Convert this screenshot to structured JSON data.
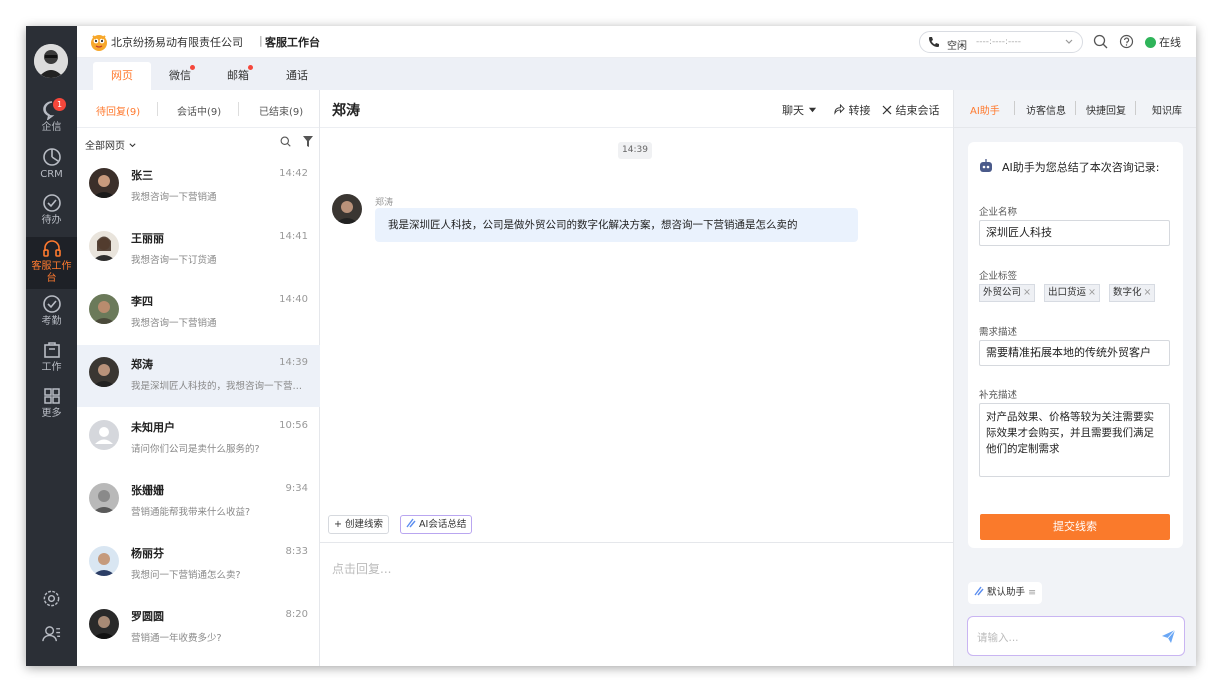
{
  "colors": {
    "accent": "#ff7a2f",
    "nav_bg": "#2b2f36",
    "online": "#2fb45a",
    "badge": "#f5473b",
    "submit": "#fa7a2b",
    "bubble": "#eaf2fd"
  },
  "topbar": {
    "company": "北京纷扬易动有限责任公司",
    "separator": "|",
    "workbench": "客服工作台",
    "phone_status": "空闲",
    "phone_number": "----:----:----",
    "online": "在线"
  },
  "leftnav": {
    "badge": "1",
    "items": [
      {
        "label": "企信",
        "icon": "chat-bubble-icon"
      },
      {
        "label": "CRM",
        "icon": "pie-chart-icon"
      },
      {
        "label": "待办",
        "icon": "check-circle-icon"
      },
      {
        "label": "客服工作台",
        "icon": "headset-icon"
      },
      {
        "label": "考勤",
        "icon": "attendance-icon"
      },
      {
        "label": "工作",
        "icon": "briefcase-icon"
      },
      {
        "label": "更多",
        "icon": "grid-icon"
      }
    ]
  },
  "channel_tabs": [
    "网页",
    "微信",
    "邮箱",
    "通话"
  ],
  "conv_tabs": [
    "待回复(9)",
    "会话中(9)",
    "已结束(9)"
  ],
  "filter": {
    "label": "全部网页"
  },
  "conversations": [
    {
      "name": "张三",
      "time": "14:42",
      "preview": "我想咨询一下营销通"
    },
    {
      "name": "王丽丽",
      "time": "14:41",
      "preview": "我想咨询一下订货通"
    },
    {
      "name": "李四",
      "time": "14:40",
      "preview": "我想咨询一下营销通"
    },
    {
      "name": "郑涛",
      "time": "14:39",
      "preview": "我是深圳匠人科技的，我想咨询一下营销通"
    },
    {
      "name": "未知用户",
      "time": "10:56",
      "preview": "请问你们公司是卖什么服务的?"
    },
    {
      "name": "张姗姗",
      "time": "9:34",
      "preview": "营销通能帮我带来什么收益?"
    },
    {
      "name": "杨丽芬",
      "time": "8:33",
      "preview": "我想问一下营销通怎么卖?"
    },
    {
      "name": "罗圆圆",
      "time": "8:20",
      "preview": "营销通一年收费多少?"
    }
  ],
  "chat": {
    "title": "郑涛",
    "mode": "聊天",
    "transfer": "转接",
    "end": "结束会话",
    "time_chip": "14:39",
    "sender": "郑涛",
    "message": "我是深圳匠人科技，公司是做外贸公司的数字化解决方案，想咨询一下营销通是怎么卖的",
    "create_lead": "创建线索",
    "ai_summary": "AI会话总结",
    "reply_placeholder": "点击回复..."
  },
  "ai_panel": {
    "tabs": [
      "AI助手",
      "访客信息",
      "快捷回复",
      "知识库"
    ],
    "header": "AI助手为您总结了本次咨询记录:",
    "company_label": "企业名称",
    "company_value": "深圳匠人科技",
    "tags_label": "企业标签",
    "tags": [
      "外贸公司",
      "出口货运",
      "数字化"
    ],
    "need_label": "需求描述",
    "need_value": "需要精准拓展本地的传统外贸客户",
    "extra_label": "补充描述",
    "extra_value": "对产品效果、价格等较为关注需要实际效果才会购买，并且需要我们满足他们的定制需求",
    "submit": "提交线索",
    "assistant": "默认助手",
    "input_placeholder": "请输入..."
  }
}
